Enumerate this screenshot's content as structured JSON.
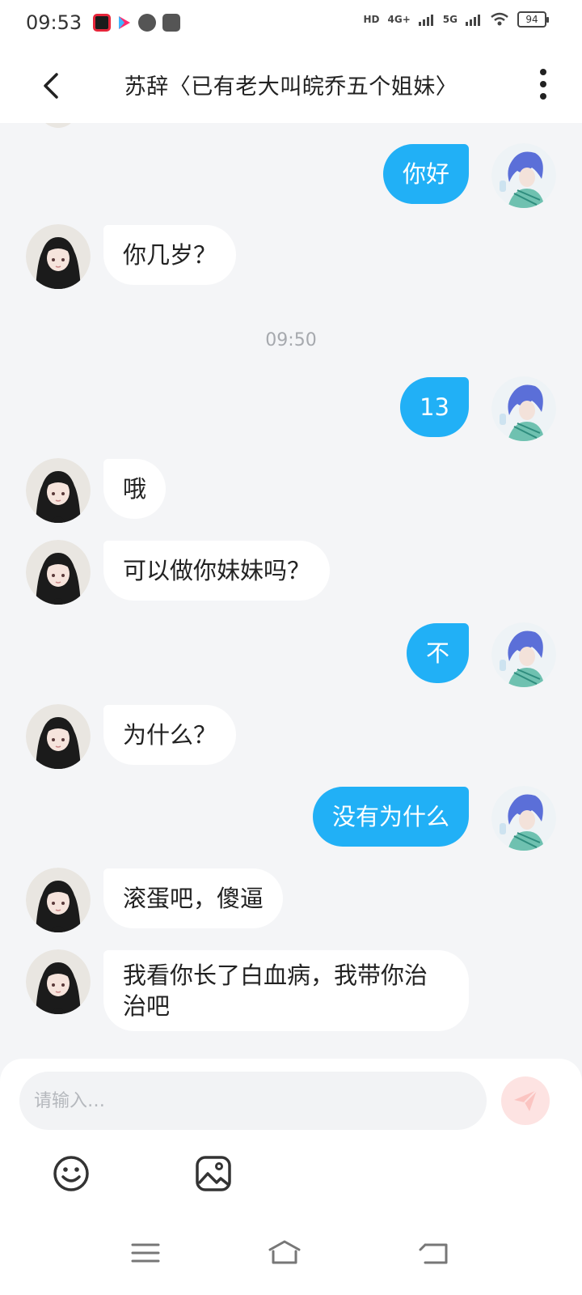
{
  "status_bar": {
    "time": "09:53",
    "hd_label": "HD",
    "net1": "4G+",
    "net2": "5G",
    "battery": "94",
    "icons": [
      "video-app-icon",
      "play-app-icon",
      "compass-app-icon",
      "media-app-icon",
      "wifi-icon",
      "signal-icon"
    ]
  },
  "header": {
    "title": "苏辞〈已有老大叫皖乔五个姐妹〉",
    "back_icon": "chevron-left-icon",
    "more_icon": "more-vertical-icon"
  },
  "messages": [
    {
      "side": "out",
      "text": "你好"
    },
    {
      "side": "in",
      "text": "你几岁？"
    },
    {
      "type": "time",
      "text": "09:50"
    },
    {
      "side": "out",
      "text": "13"
    },
    {
      "side": "in",
      "text": "哦"
    },
    {
      "side": "in",
      "text": "可以做你妹妹吗？"
    },
    {
      "side": "out",
      "text": "不"
    },
    {
      "side": "in",
      "text": "为什么？"
    },
    {
      "side": "out",
      "text": "没有为什么"
    },
    {
      "side": "in",
      "text": "滚蛋吧，傻逼"
    },
    {
      "side": "in",
      "text": "我看你长了白血病，我带你治治吧"
    }
  ],
  "composer": {
    "placeholder": "请输入…",
    "send_icon": "send-icon",
    "emoji_icon": "emoji-icon",
    "image_icon": "image-icon"
  },
  "nav": {
    "menu_icon": "menu-icon",
    "home_icon": "home-icon",
    "back_icon": "back-icon"
  },
  "colors": {
    "accent": "#21b0f6",
    "incoming_bubble": "#ffffff",
    "chat_background": "#f4f5f7",
    "send_button": "#fde3e2"
  }
}
